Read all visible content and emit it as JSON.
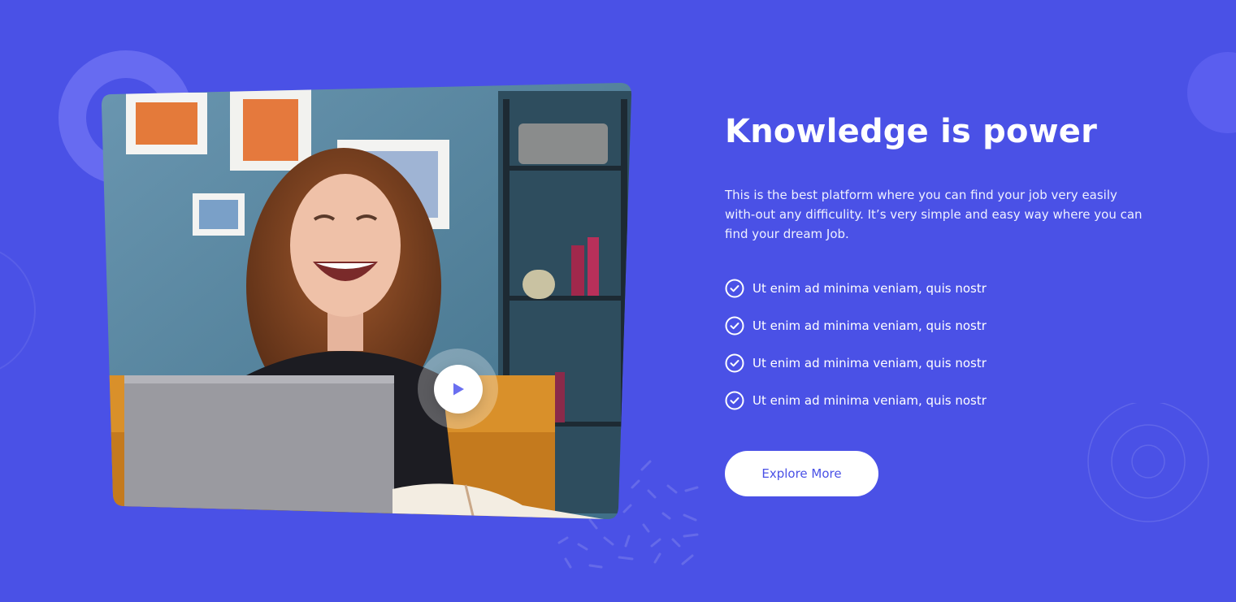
{
  "hero": {
    "title": "Knowledge is power",
    "description": "This is the best platform where you can find your job very easily with-out any difficulity. It’s very simple and easy way where you can find your dream Job.",
    "checklist": [
      {
        "label": "Ut enim ad minima veniam, quis nostr",
        "icon": "check-circle-icon"
      },
      {
        "label": "Ut enim ad minima veniam, quis nostr",
        "icon": "check-circle-icon"
      },
      {
        "label": "Ut enim ad minima veniam, quis nostr",
        "icon": "check-circle-icon"
      },
      {
        "label": "Ut enim ad minima veniam, quis nostr",
        "icon": "check-circle-icon"
      }
    ],
    "cta_label": "Explore More"
  },
  "media": {
    "play_icon": "play-icon",
    "image_description_icon": "video-thumbnail"
  },
  "colors": {
    "background": "#4a51e6",
    "accent": "#4a51e6",
    "text": "#ffffff",
    "button_bg": "#ffffff"
  }
}
